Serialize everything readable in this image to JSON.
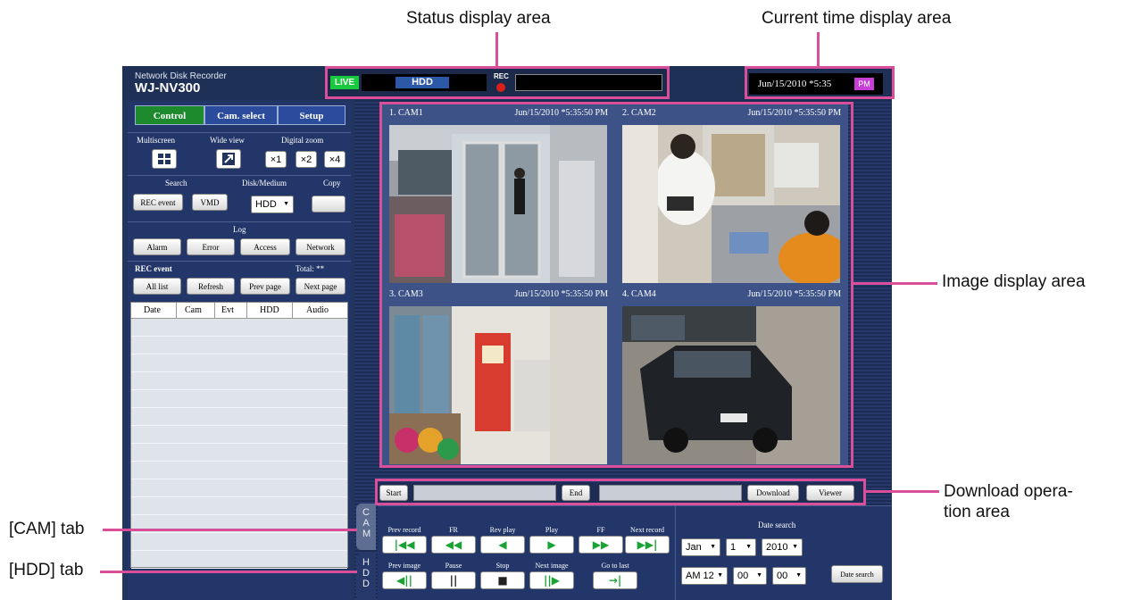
{
  "callouts": {
    "status_area": "Status display area",
    "time_area": "Current time display area",
    "image_area": "Image display area",
    "download_area_line1": "Download opera-",
    "download_area_line2": "tion area",
    "cam_tab": "[CAM] tab",
    "hdd_tab": "[HDD] tab"
  },
  "header": {
    "product": "Network Disk Recorder",
    "model": "WJ-NV300"
  },
  "status": {
    "live": "LIVE",
    "hdd": "HDD",
    "rec": "REC"
  },
  "time": {
    "value": "Jun/15/2010  *5:35",
    "ampm": "PM"
  },
  "tabs": {
    "control": "Control",
    "cam_select": "Cam. select",
    "setup": "Setup"
  },
  "controls": {
    "multiscreen": "Multiscreen",
    "wide_view": "Wide view",
    "digital_zoom": "Digital zoom",
    "zoom_levels": [
      "×1",
      "×2",
      "×4"
    ],
    "search": "Search",
    "disk_medium": "Disk/Medium",
    "copy": "Copy",
    "rec_event_btn": "REC event",
    "vmd_btn": "VMD",
    "disk_value": "HDD",
    "log": "Log",
    "log_buttons": [
      "Alarm",
      "Error",
      "Access",
      "Network"
    ],
    "rec_event_title": "REC event",
    "total": "Total: **",
    "list_buttons": [
      "All list",
      "Refresh",
      "Prev page",
      "Next page"
    ]
  },
  "event_table": {
    "columns": [
      "Date",
      "Cam",
      "Evt",
      "HDD",
      "Audio"
    ],
    "empty_rows": 14
  },
  "cameras": [
    {
      "name": "1. CAM1",
      "time": "Jun/15/2010  *5:35:50 PM"
    },
    {
      "name": "2. CAM2",
      "time": "Jun/15/2010  *5:35:50 PM"
    },
    {
      "name": "3. CAM3",
      "time": "Jun/15/2010  *5:35:50 PM"
    },
    {
      "name": "4. CAM4",
      "time": "Jun/15/2010  *5:35:50 PM"
    }
  ],
  "download": {
    "start": "Start",
    "end": "End",
    "download": "Download",
    "viewer": "Viewer"
  },
  "side_tabs": {
    "cam": "CAM",
    "hdd": "HDD"
  },
  "playback": {
    "labels_row1": [
      "Prev record",
      "FR",
      "Rev play",
      "Play",
      "FF",
      "Next record"
    ],
    "labels_row2": [
      "Prev image",
      "Pause",
      "Stop",
      "Next image",
      "Go to last"
    ],
    "icons_row1": [
      "prev-record-icon",
      "fast-rewind-icon",
      "reverse-play-icon",
      "play-icon",
      "fast-forward-icon",
      "next-record-icon"
    ],
    "icons_row2": [
      "prev-image-icon",
      "pause-icon",
      "stop-icon",
      "next-image-icon",
      "go-to-last-icon"
    ]
  },
  "date_search": {
    "title": "Date search",
    "month": "Jan",
    "day": "1",
    "year": "2010",
    "hour": "AM 12",
    "minute": "00",
    "second": "00",
    "button": "Date search"
  },
  "colors": {
    "callout_pink": "#d94f9a",
    "app_navy": "#22355e",
    "active_tab_green": "#1e8a2e",
    "live_green": "#19c93f",
    "pm_magenta": "#c63fd6"
  }
}
